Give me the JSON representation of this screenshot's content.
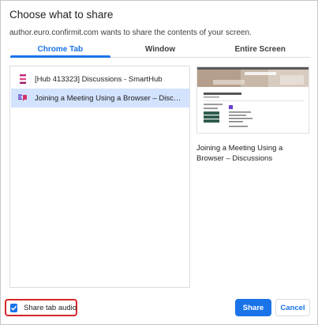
{
  "dialog": {
    "title": "Choose what to share",
    "subtitle": "author.euro.confirmit.com wants to share the contents of your screen."
  },
  "tabs": [
    {
      "label": "Chrome Tab",
      "active": true
    },
    {
      "label": "Window",
      "active": false
    },
    {
      "label": "Entire Screen",
      "active": false
    }
  ],
  "tab_list": [
    {
      "label": "[Hub 413323] Discussions - SmartHub",
      "icon": "smarthub-icon",
      "selected": false
    },
    {
      "label": "Joining a Meeting Using a Browser – Discussions",
      "icon": "discussions-icon",
      "selected": true
    }
  ],
  "preview": {
    "caption": "Joining a Meeting Using a Browser – Discussions"
  },
  "footer": {
    "share_audio_label": "Share tab audio",
    "share_audio_checked": true,
    "share_label": "Share",
    "cancel_label": "Cancel"
  },
  "colors": {
    "accent": "#1a73e8",
    "selected_row": "#d3e3fd",
    "highlight_ring": "#d9262c"
  }
}
